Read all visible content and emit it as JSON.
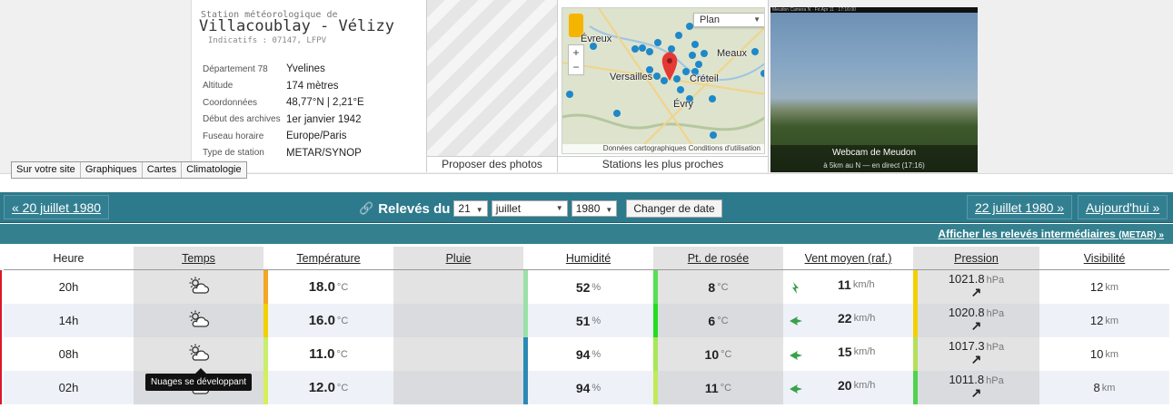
{
  "station": {
    "subtitle": "Station météorologique de",
    "name": "Villacoublay - Vélizy",
    "codes": "Indicatifs : 07147, LFPV",
    "info": [
      {
        "label": "Département 78",
        "value": "Yvelines"
      },
      {
        "label": "Altitude",
        "value": "174 mètres"
      },
      {
        "label": "Coordonnées",
        "value": "48,77°N | 2,21°E"
      },
      {
        "label": "Début des archives",
        "value": "1er janvier 1942"
      },
      {
        "label": "Fuseau horaire",
        "value": "Europe/Paris"
      },
      {
        "label": "Type de station",
        "value": "METAR/SYNOP"
      }
    ]
  },
  "tabs": [
    "Sur votre site",
    "Graphiques",
    "Cartes",
    "Climatologie"
  ],
  "photos": {
    "caption": "Proposer des photos"
  },
  "map": {
    "caption": "Stations les plus proches",
    "plan": "Plan",
    "footer": "Données cartographiques   Conditions d'utilisation",
    "places": [
      "Évreux",
      "Meaux",
      "Versailles",
      "Créteil",
      "Évry"
    ],
    "zoom_in": "+",
    "zoom_out": "−",
    "colors": {
      "pin": "#1e88c9",
      "main_pin": "#e53935"
    }
  },
  "webcam": {
    "caption": "Webcam de Meudon",
    "subcaption": "à 5km au N — en direct (17:16)",
    "header": "Meudon Camera N · Fri Apr 11 · 17:16:00"
  },
  "nav": {
    "prev": "« 20 juillet 1980",
    "label": "Relevés du",
    "day": "21",
    "month": "juillet",
    "year": "1980",
    "change": "Changer de date",
    "next": "22 juillet 1980 »",
    "today": "Aujourd'hui »"
  },
  "meta_link": {
    "text": "Afficher les relevés intermédiaires",
    "suffix": "(METAR) »"
  },
  "columns": [
    "Heure",
    "Temps",
    "Température",
    "Pluie",
    "Humidité",
    "Pt. de rosée",
    "Vent moyen (raf.)",
    "Pression",
    "Visibilité"
  ],
  "rows": [
    {
      "hour": "20h",
      "temp": "18.0",
      "hum": "52",
      "dew": "8",
      "wind": "11",
      "pres": "1021.8",
      "vis": "12",
      "colors": {
        "temp": "#f5a623",
        "hum": "#9be0a8",
        "dew": "#55e055",
        "pres": "#f4d000"
      }
    },
    {
      "hour": "14h",
      "temp": "16.0",
      "hum": "51",
      "dew": "6",
      "wind": "22",
      "pres": "1020.8",
      "vis": "12",
      "colors": {
        "temp": "#f3d000",
        "hum": "#9be0a8",
        "dew": "#22dd22",
        "pres": "#f4d000"
      }
    },
    {
      "hour": "08h",
      "temp": "11.0",
      "hum": "94",
      "dew": "10",
      "wind": "15",
      "pres": "1017.3",
      "vis": "10",
      "colors": {
        "temp": "#c8ee6a",
        "hum": "#2b8ab5",
        "dew": "#a6e85a",
        "pres": "#b6df5a"
      }
    },
    {
      "hour": "02h",
      "temp": "12.0",
      "hum": "94",
      "dew": "11",
      "wind": "20",
      "pres": "1011.8",
      "vis": "8",
      "colors": {
        "temp": "#d6ee5a",
        "hum": "#2b8ab5",
        "dew": "#c0ea5a",
        "pres": "#4fd34f"
      }
    }
  ],
  "units": {
    "temp": "°C",
    "hum": "%",
    "dew": "°C",
    "wind": "km/h",
    "pres": "hPa",
    "vis": "km"
  },
  "tooltip": "Nuages se développant",
  "icons": {
    "weather": "cloud-sun-icon",
    "wind": "wind-arrow-icon",
    "pressure": "up-right-arrow",
    "link": "link-icon"
  }
}
